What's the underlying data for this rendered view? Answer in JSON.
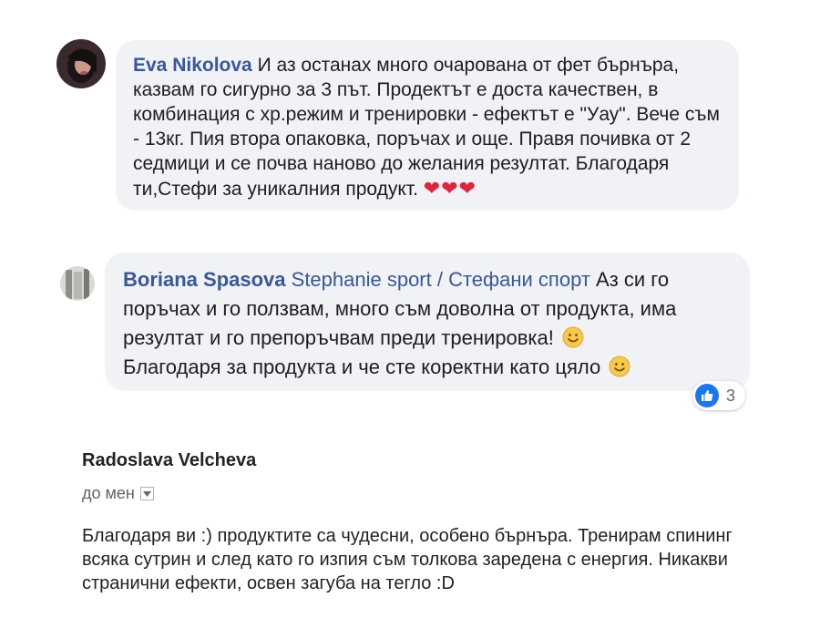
{
  "comments": [
    {
      "author": "Eva Nikolova",
      "text": "И аз останах много очарована от фет бърнъра, казвам го сигурно за 3 път. Продектът е доста качествен, в комбинация с хр.режим и тренировки - ефектът е \"Уау\". Вече съм - 13кг. Пия втора опаковка, поръчах и още. Правя почивка от 2 седмици и се почва наново до желания резултат. Благодаря ти,Стефи за уникалния продукт.",
      "emoji": "❤❤❤"
    },
    {
      "author": "Boriana Spasova",
      "mention": "Stephanie sport / Стефани спорт",
      "text_1": "Аз си го поръчах и го ползвам, много съм доволна от продукта, има резултат и го препоръчвам преди тренировка!",
      "text_2": "Благодаря за продукта и че сте коректни като цяло",
      "reaction_count": "3",
      "reaction_icon": "like-icon"
    }
  ],
  "email": {
    "sender": "Radoslava Velcheva",
    "to": "до мен",
    "body": "Благодаря ви :) продуктите са чудесни, особено бърнъра. Тренирам спининг всяка сутрин и след като го изпия съм толкова заредена с енергия. Никакви странични ефекти, освен загуба на тегло :D"
  },
  "colors": {
    "author_link": "#385898",
    "bubble_bg": "#f0f2f5",
    "like_blue": "#1877f2",
    "heart_red": "#e0243c"
  }
}
